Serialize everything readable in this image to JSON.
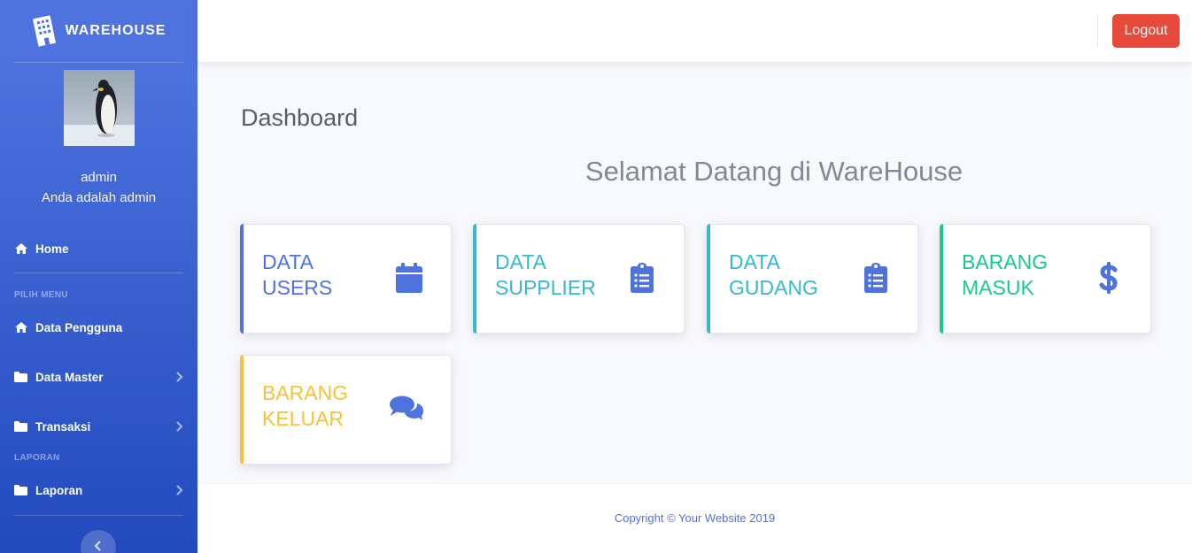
{
  "brand": {
    "title": "WAREHOUSE",
    "icon": "building-icon"
  },
  "user": {
    "name": "admin",
    "role_text": "Anda adalah admin",
    "avatar": "penguin-avatar"
  },
  "sidebar": {
    "home_label": "Home",
    "section_menu": "PILIH MENU",
    "items": [
      {
        "label": "Data Pengguna",
        "icon": "home-icon"
      },
      {
        "label": "Data Master",
        "icon": "folder-icon"
      },
      {
        "label": "Transaksi",
        "icon": "folder-icon"
      }
    ],
    "section_report": "LAPORAN",
    "report_item": {
      "label": "Laporan",
      "icon": "folder-icon"
    }
  },
  "topbar": {
    "logout_label": "Logout"
  },
  "main": {
    "title": "Dashboard",
    "welcome": "Selamat Datang di WareHouse",
    "cards": [
      {
        "label": "DATA USERS",
        "icon": "calendar-icon",
        "color": "#4e73df"
      },
      {
        "label": "DATA SUPPLIER",
        "icon": "clipboard-list-icon",
        "color": "#36b9cc"
      },
      {
        "label": "DATA GUDANG",
        "icon": "clipboard-list-icon",
        "color": "#36b9cc"
      },
      {
        "label": "BARANG MASUK",
        "icon": "dollar-icon",
        "color": "#1cc88a"
      },
      {
        "label": "BARANG KELUAR",
        "icon": "comments-icon",
        "color": "#f6c23e"
      }
    ]
  },
  "footer": {
    "copyright": "Copyright © Your Website 2019"
  },
  "colors": {
    "primary": "#4e73df",
    "info": "#36b9cc",
    "success": "#1cc88a",
    "warning": "#f6c23e",
    "danger": "#e74a3b"
  }
}
